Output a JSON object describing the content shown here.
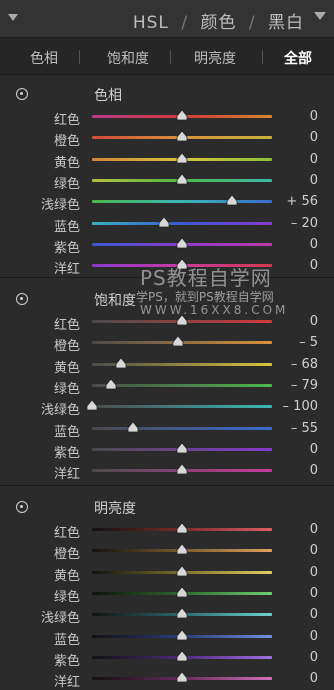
{
  "header": {
    "titles": [
      "HSL",
      "颜色",
      "黑白"
    ],
    "separator": "/"
  },
  "tabs": [
    "色相",
    "饱和度",
    "明亮度",
    "全部"
  ],
  "active_tab": "全部",
  "sections": [
    {
      "title": "色相",
      "rows": [
        {
          "label": "红色",
          "value": "0",
          "level": 0,
          "track": "linear-gradient(to right,#b83a8a,#d23a3a,#d5852a)"
        },
        {
          "label": "橙色",
          "value": "0",
          "level": 0,
          "track": "linear-gradient(to right,#d24a3a,#d8923a,#c9b13a)"
        },
        {
          "label": "黄色",
          "value": "0",
          "level": 0,
          "track": "linear-gradient(to right,#d2843a,#d8c43a,#8cc03a)"
        },
        {
          "label": "绿色",
          "value": "0",
          "level": 0,
          "track": "linear-gradient(to right,#b4c03a,#4cb84a,#3ab8a8)"
        },
        {
          "label": "浅绿色",
          "value": "+ 56",
          "level": 56,
          "track": "linear-gradient(to right,#4ab84a,#3ab8b8,#3a6ad0)"
        },
        {
          "label": "蓝色",
          "value": "– 20",
          "level": -20,
          "track": "linear-gradient(to right,#3ab0c0,#3a58d0,#8a3ad0)"
        },
        {
          "label": "紫色",
          "value": "0",
          "level": 0,
          "track": "linear-gradient(to right,#3a5ad0,#8a3ad0,#c03aa8)"
        },
        {
          "label": "洋红",
          "value": "0",
          "level": 0,
          "track": "linear-gradient(to right,#8a3ad0,#c83aa0,#d23a4a)"
        }
      ]
    },
    {
      "title": "饱和度",
      "rows": [
        {
          "label": "红色",
          "value": "0",
          "level": 0,
          "track": "linear-gradient(to right,#4a4a4a,#d23a3a)"
        },
        {
          "label": "橙色",
          "value": "– 5",
          "level": -5,
          "track": "linear-gradient(to right,#4a4a4a,#d8923a)"
        },
        {
          "label": "黄色",
          "value": "– 68",
          "level": -68,
          "track": "linear-gradient(to right,#4a4a4a,#d8c43a)"
        },
        {
          "label": "绿色",
          "value": "– 79",
          "level": -79,
          "track": "linear-gradient(to right,#4a4a4a,#4cb84a)"
        },
        {
          "label": "浅绿色",
          "value": "– 100",
          "level": -100,
          "track": "linear-gradient(to right,#4a4a4a,#3ab8b8)"
        },
        {
          "label": "蓝色",
          "value": "– 55",
          "level": -55,
          "track": "linear-gradient(to right,#4a4a4a,#3a6ad0)"
        },
        {
          "label": "紫色",
          "value": "0",
          "level": 0,
          "track": "linear-gradient(to right,#4a4a4a,#8a3ad0)"
        },
        {
          "label": "洋红",
          "value": "0",
          "level": 0,
          "track": "linear-gradient(to right,#4a4a4a,#c83aa0)"
        }
      ]
    },
    {
      "title": "明亮度",
      "rows": [
        {
          "label": "红色",
          "value": "0",
          "level": 0,
          "track": "linear-gradient(to right,#111,#7a2a2a,#e06060)"
        },
        {
          "label": "橙色",
          "value": "0",
          "level": 0,
          "track": "linear-gradient(to right,#111,#7a5a2a,#e0a060)"
        },
        {
          "label": "黄色",
          "value": "0",
          "level": 0,
          "track": "linear-gradient(to right,#111,#7a702a,#e0d060)"
        },
        {
          "label": "绿色",
          "value": "0",
          "level": 0,
          "track": "linear-gradient(to right,#111,#2a6a2a,#70d070)"
        },
        {
          "label": "浅绿色",
          "value": "0",
          "level": 0,
          "track": "linear-gradient(to right,#111,#2a6a6a,#70d0d0)"
        },
        {
          "label": "蓝色",
          "value": "0",
          "level": 0,
          "track": "linear-gradient(to right,#111,#2a3a7a,#7090e0)"
        },
        {
          "label": "紫色",
          "value": "0",
          "level": 0,
          "track": "linear-gradient(to right,#111,#4a2a7a,#a070e0)"
        },
        {
          "label": "洋红",
          "value": "0",
          "level": 0,
          "track": "linear-gradient(to right,#111,#6a2a5a,#d070c0)"
        }
      ]
    }
  ],
  "watermark": {
    "line1": "PS教程自学网",
    "line2": "学PS，就到PS教程自学网",
    "line3": "WWW.16XX8.COM"
  },
  "icons": {
    "collapse": "triangle-down-icon",
    "menu": "triangle-down-icon",
    "target": "target-adjust-icon",
    "thumb": "slider-thumb-icon"
  }
}
